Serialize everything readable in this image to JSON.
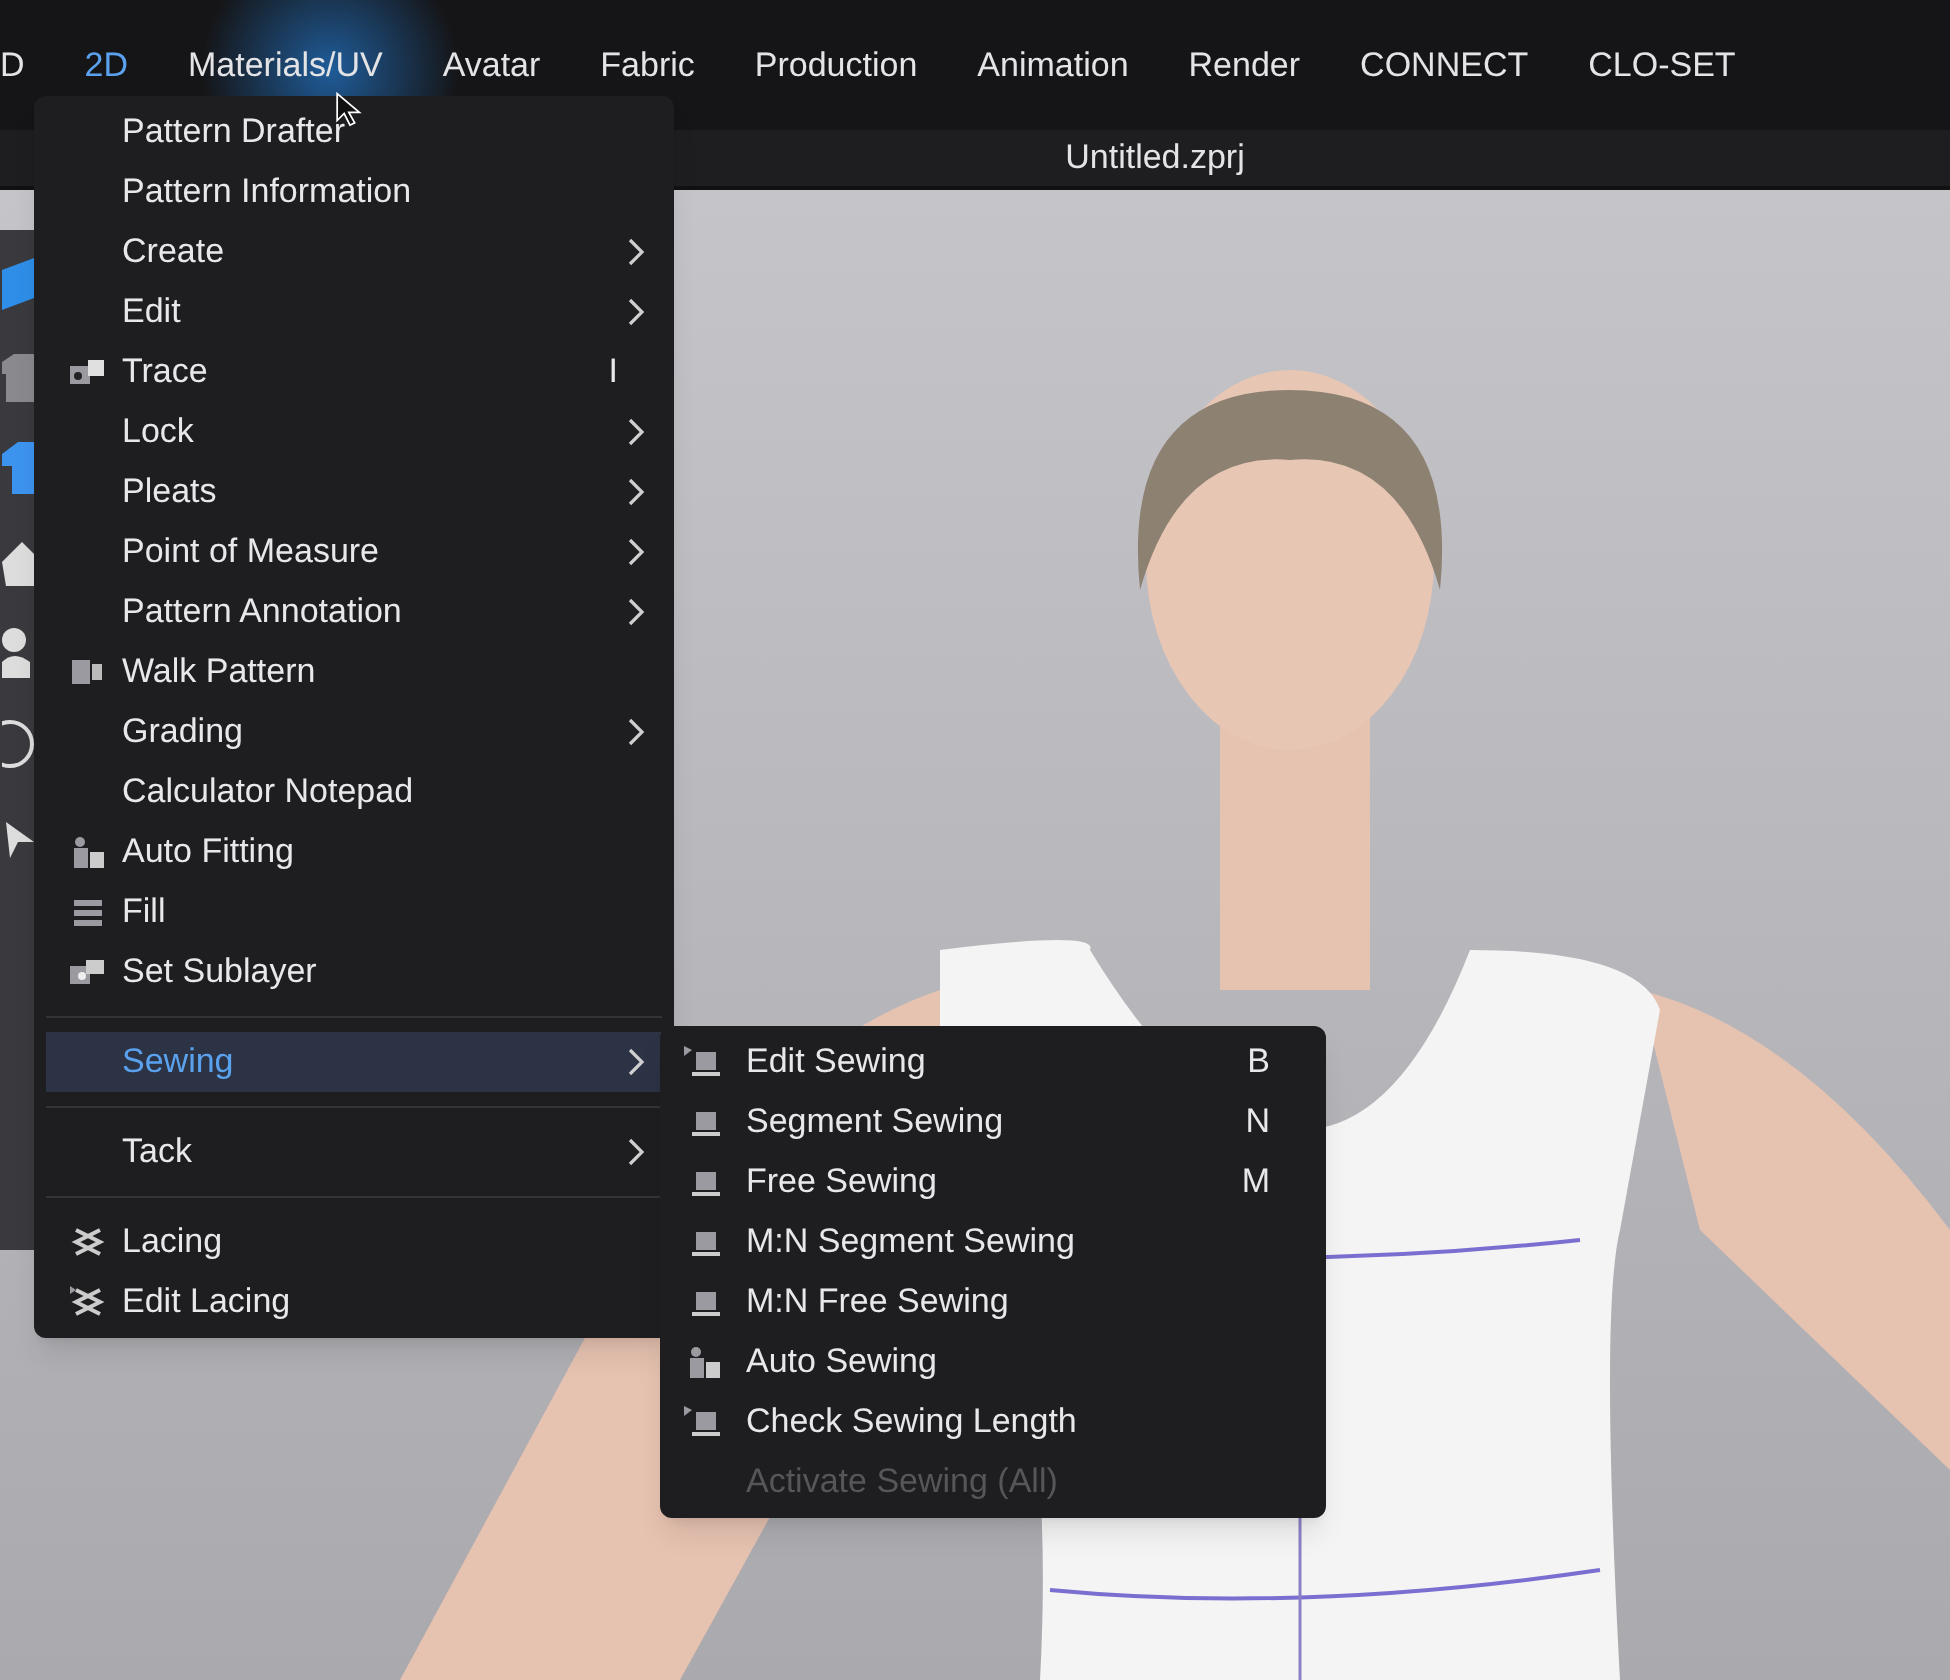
{
  "menubar": [
    {
      "label": "D",
      "selected": false
    },
    {
      "label": "2D",
      "selected": true
    },
    {
      "label": "Materials/UV",
      "selected": false
    },
    {
      "label": "Avatar",
      "selected": false
    },
    {
      "label": "Fabric",
      "selected": false
    },
    {
      "label": "Production",
      "selected": false
    },
    {
      "label": "Animation",
      "selected": false
    },
    {
      "label": "Render",
      "selected": false
    },
    {
      "label": "CONNECT",
      "selected": false
    },
    {
      "label": "CLO-SET",
      "selected": false
    }
  ],
  "window": {
    "title": "Untitled.zprj"
  },
  "menu": {
    "items": [
      {
        "kind": "item",
        "label": "Pattern Drafter",
        "submenu": false,
        "selected": false
      },
      {
        "kind": "item",
        "label": "Pattern Information",
        "submenu": false,
        "selected": false
      },
      {
        "kind": "item",
        "label": "Create",
        "submenu": true,
        "selected": false
      },
      {
        "kind": "item",
        "label": "Edit",
        "submenu": true,
        "selected": false
      },
      {
        "kind": "item",
        "label": "Trace",
        "shortcut": "I",
        "submenu": false,
        "selected": false
      },
      {
        "kind": "item",
        "label": "Lock",
        "submenu": true,
        "selected": false
      },
      {
        "kind": "item",
        "label": "Pleats",
        "submenu": true,
        "selected": false
      },
      {
        "kind": "item",
        "label": "Point of Measure",
        "submenu": true,
        "selected": false
      },
      {
        "kind": "item",
        "label": "Pattern Annotation",
        "submenu": true,
        "selected": false
      },
      {
        "kind": "item",
        "label": "Walk Pattern",
        "submenu": false,
        "selected": false
      },
      {
        "kind": "item",
        "label": "Grading",
        "submenu": true,
        "selected": false
      },
      {
        "kind": "item",
        "label": "Calculator Notepad",
        "submenu": false,
        "selected": false
      },
      {
        "kind": "item",
        "label": "Auto Fitting",
        "submenu": false,
        "selected": false
      },
      {
        "kind": "item",
        "label": "Fill",
        "submenu": false,
        "selected": false
      },
      {
        "kind": "item",
        "label": "Set Sublayer",
        "submenu": false,
        "selected": false
      },
      {
        "kind": "separator"
      },
      {
        "kind": "item",
        "label": "Sewing",
        "submenu": true,
        "selected": true
      },
      {
        "kind": "separator"
      },
      {
        "kind": "item",
        "label": "Tack",
        "submenu": true,
        "selected": false
      },
      {
        "kind": "separator"
      },
      {
        "kind": "item",
        "label": "Lacing",
        "submenu": false,
        "selected": false
      },
      {
        "kind": "item",
        "label": "Edit Lacing",
        "submenu": false,
        "selected": false
      }
    ]
  },
  "submenu": {
    "items": [
      {
        "label": "Edit Sewing",
        "shortcut": "B",
        "disabled": false
      },
      {
        "label": "Segment Sewing",
        "shortcut": "N",
        "disabled": false
      },
      {
        "label": "Free Sewing",
        "shortcut": "M",
        "disabled": false
      },
      {
        "label": "M:N Segment Sewing",
        "disabled": false
      },
      {
        "label": "M:N Free Sewing",
        "disabled": false
      },
      {
        "label": "Auto Sewing",
        "disabled": false
      },
      {
        "label": "Check Sewing Length",
        "disabled": false
      },
      {
        "label": "Activate Sewing (All)",
        "disabled": true
      }
    ]
  }
}
